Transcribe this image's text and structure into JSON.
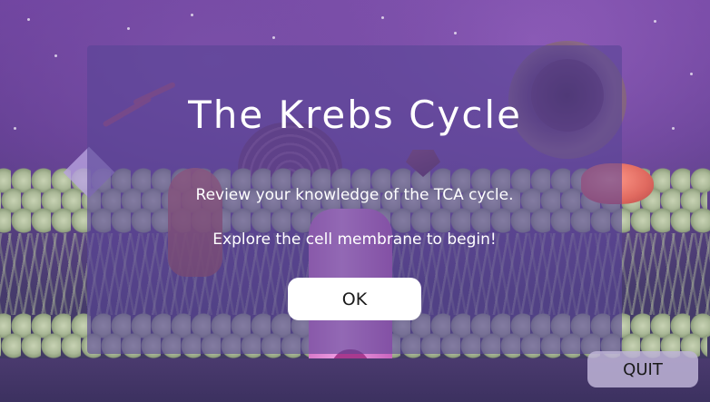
{
  "dialog": {
    "title": "The Krebs Cycle",
    "line1": "Review your knowledge of the TCA cycle.",
    "line2": "Explore the cell membrane to begin!",
    "ok_label": "OK"
  },
  "quit_label": "QUIT",
  "colors": {
    "dialog_overlay": "#58469699",
    "button_bg": "#ffffff",
    "quit_bg": "#beb4d7",
    "text": "#ffffff"
  }
}
